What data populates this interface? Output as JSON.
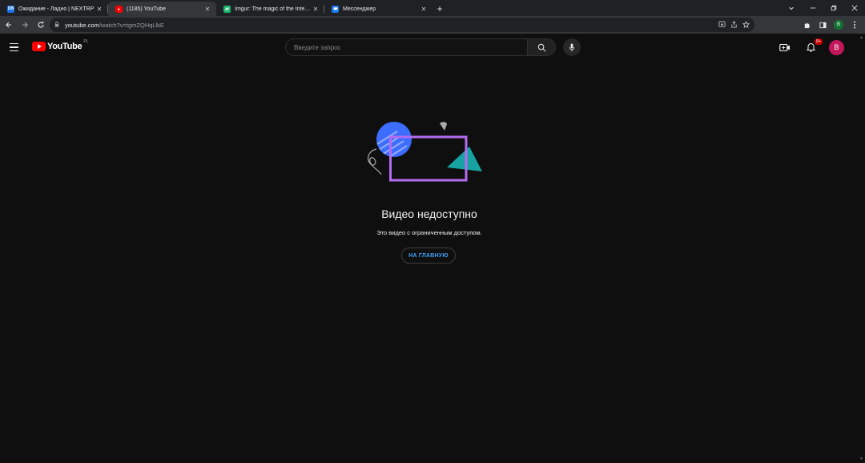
{
  "browser": {
    "tabs": [
      {
        "title": "Ожидание - Ладно | NEXTRP",
        "favicon": "nextrp-favicon",
        "favicon_color": "#1a73e8",
        "favicon_text": "DB"
      },
      {
        "title": "(1185) YouTube",
        "favicon": "youtube-favicon",
        "favicon_color": "#ff0000",
        "active": true
      },
      {
        "title": "Imgur: The magic of the Internet",
        "favicon": "imgur-favicon",
        "favicon_color": "#1bb76e"
      },
      {
        "title": "Мессенджер",
        "favicon": "messenger-favicon",
        "favicon_color": "#1877f2"
      }
    ],
    "close_glyph": "✕",
    "new_tab_glyph": "+",
    "url_host": "youtube.com",
    "url_path": "/watch?v=tgmZQHqLlkE",
    "profile_initial": "B"
  },
  "header": {
    "logo_text": "YouTube",
    "region": "PL",
    "search_placeholder": "Введите запрос",
    "notification_count": "9+",
    "avatar_initial": "B"
  },
  "error": {
    "title": "Видео недоступно",
    "message": "Это видео с ограниченным доступом.",
    "home_button": "НА ГЛАВНУЮ"
  },
  "colors": {
    "background": "#0f0f0f",
    "accent_link": "#3ea6ff",
    "illustration_blue": "#3d6dff",
    "illustration_purple": "#b36cf0",
    "illustration_teal": "#18a3a3"
  }
}
